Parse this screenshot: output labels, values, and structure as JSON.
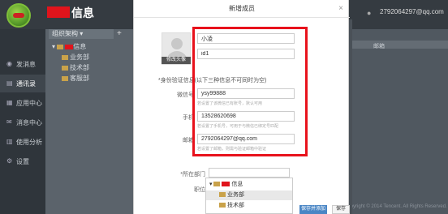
{
  "header": {
    "brand": "信息",
    "user_email": "2792064297@qq.com"
  },
  "sidebar": {
    "items": [
      {
        "label": "发消息",
        "icon": "send-icon"
      },
      {
        "label": "通讯录",
        "icon": "contacts-icon",
        "active": true
      },
      {
        "label": "应用中心",
        "icon": "apps-icon"
      },
      {
        "label": "消息中心",
        "icon": "message-icon"
      },
      {
        "label": "使用分析",
        "icon": "analytics-icon"
      },
      {
        "label": "设置",
        "icon": "settings-icon"
      }
    ]
  },
  "org": {
    "selector_label": "组织架构",
    "tree": {
      "root": "信息",
      "children": [
        "业务部",
        "技术部",
        "客服部"
      ]
    },
    "email_col": "邮箱"
  },
  "footer": "Copyright © 2014 Tencent. All Rights Reserved.",
  "modal": {
    "title": "新增成员",
    "avatar_button": "修改头像",
    "name_value": "小凌",
    "id_value": "id1",
    "section_label": "*身份验证信息",
    "section_note": "(以下三种信息不可同时为空)",
    "fields": [
      {
        "label": "微信号",
        "value": "ysy99888",
        "hint": "若设置了该微信已有账号，默认可用"
      },
      {
        "label": "手机",
        "value": "13528620698",
        "hint": "若设置了手机号，可用于与微信已绑定号匹配"
      },
      {
        "label": "邮箱",
        "value": "2792064297@qq.com",
        "hint": "若设置了邮箱，则需与验证邮箱中验证"
      }
    ],
    "dept_label": "*所在部门",
    "position_label": "职位",
    "dropdown": {
      "root": "信息",
      "items": [
        "业务部",
        "技术部"
      ]
    },
    "btn_add_next": "保存并添加下一个",
    "btn_save": "保存"
  },
  "colors": {
    "highlight": "#e8121c",
    "brand_red": "#e0141c",
    "primary": "#4a86c5"
  }
}
